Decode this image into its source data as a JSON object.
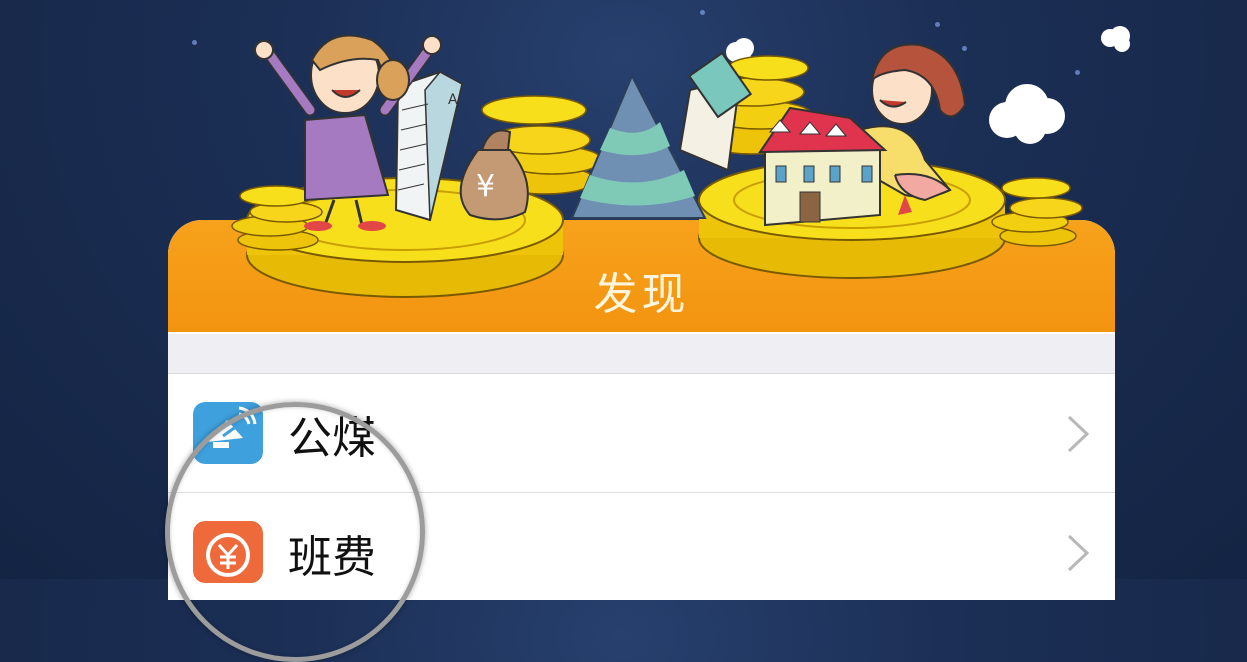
{
  "header": {
    "title": "发现"
  },
  "menu": [
    {
      "label": "公煤",
      "icon": "satellite-dish-icon",
      "icon_color": "#3ea0dc"
    },
    {
      "label": "班费",
      "icon": "yuan-coin-icon",
      "icon_color": "#ef6a3a"
    }
  ],
  "illustration": {
    "building_letter": "A",
    "bag_symbol": "¥"
  },
  "colors": {
    "header_orange": "#f39410",
    "background_navy": "#1b2e54",
    "coin_gold": "#f6d20a"
  }
}
